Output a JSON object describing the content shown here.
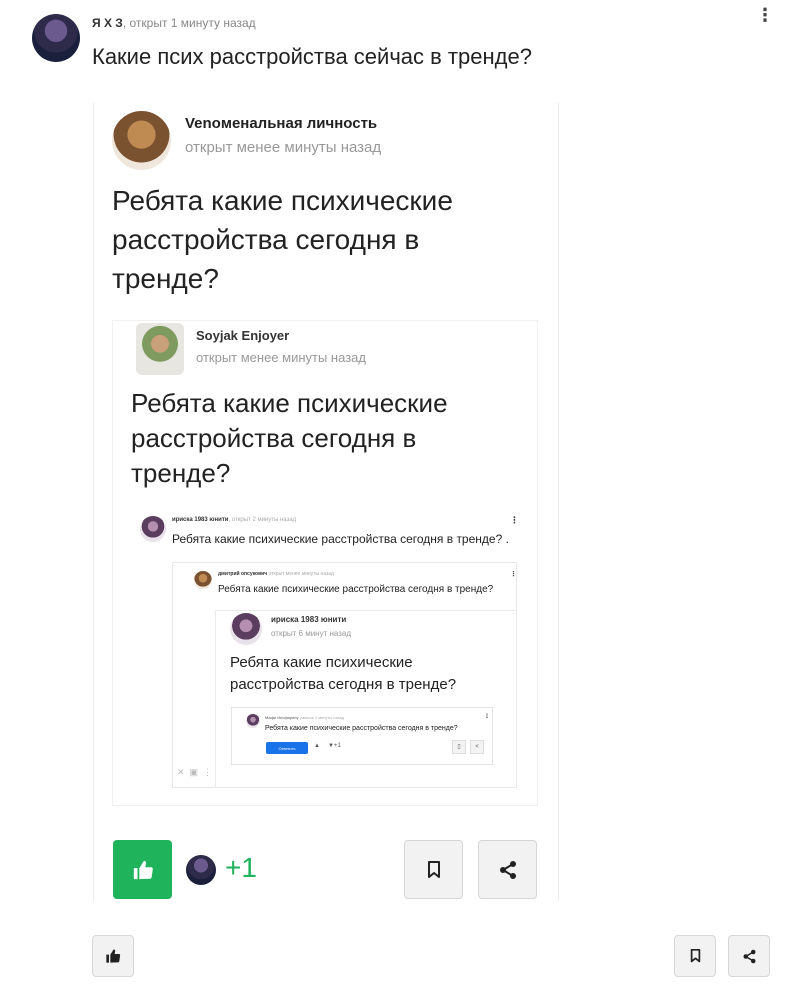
{
  "post": {
    "author": "Я Х З",
    "meta": ", открыт 1 минуту назад",
    "title": "Какие псих расстройства сейчас в тренде?"
  },
  "embed1": {
    "author": "Venoменальная личность",
    "meta": "открыт менее минуты назад",
    "title": "Ребята какие психические расстройства сегодня в тренде?",
    "likes": "+1"
  },
  "embed2": {
    "author": "Soyjak Enjoyer",
    "meta": "открыт менее минуты назад",
    "title": "Ребята какие психические расстройства сегодня в тренде?"
  },
  "embed3": {
    "author": "ириска 1983 юнити",
    "meta": ", открыт 2 минуты назад",
    "title": "Ребята какие психические расстройства сегодня в тренде? ."
  },
  "embed4": {
    "author": "дмитрий опсукович",
    "meta": "открыт менее минуты назад",
    "title": "Ребята какие психические расстройства сегодня в тренде?"
  },
  "embed5": {
    "author": "ириска 1983 юнити",
    "meta": "открыт 6 минут назад",
    "title": "Ребята какие психические расстройства сегодня в тренде?"
  },
  "embed6": {
    "author": "Мафи Инсфирелу",
    "meta": "раньше 1 минуты назад",
    "title": "Ребята какие психические расстройства сегодня в тренде?",
    "reply": "Ответить",
    "likes": "+1"
  },
  "colors": {
    "green": "#1fb35c",
    "blue": "#1a73e8"
  }
}
